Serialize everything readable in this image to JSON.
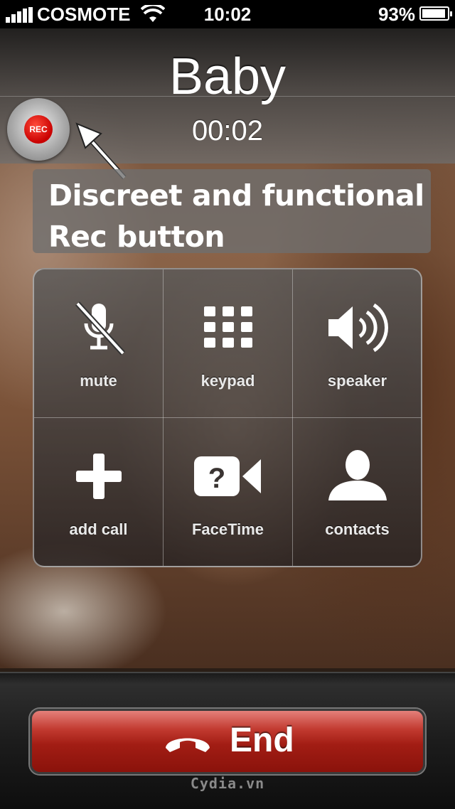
{
  "status_bar": {
    "carrier": "COSMOTE",
    "time": "10:02",
    "battery_percent": "93%",
    "icons": [
      "signal-bars-icon",
      "wifi-icon",
      "battery-icon"
    ]
  },
  "call": {
    "caller_name": "Baby",
    "duration": "00:02"
  },
  "rec_button": {
    "label": "REC",
    "color": "#d40000"
  },
  "annotation": {
    "line1": "Discreet and functional",
    "line2": "Rec button"
  },
  "controls": [
    {
      "label": "mute",
      "icon": "mute-icon"
    },
    {
      "label": "keypad",
      "icon": "keypad-icon"
    },
    {
      "label": "speaker",
      "icon": "speaker-icon"
    },
    {
      "label": "add call",
      "icon": "add-call-icon"
    },
    {
      "label": "FaceTime",
      "icon": "facetime-icon"
    },
    {
      "label": "contacts",
      "icon": "contacts-icon"
    }
  ],
  "end_button": {
    "label": "End",
    "icon": "hang-up-icon",
    "color": "#b0261c"
  },
  "watermark": "Cydia.vn"
}
